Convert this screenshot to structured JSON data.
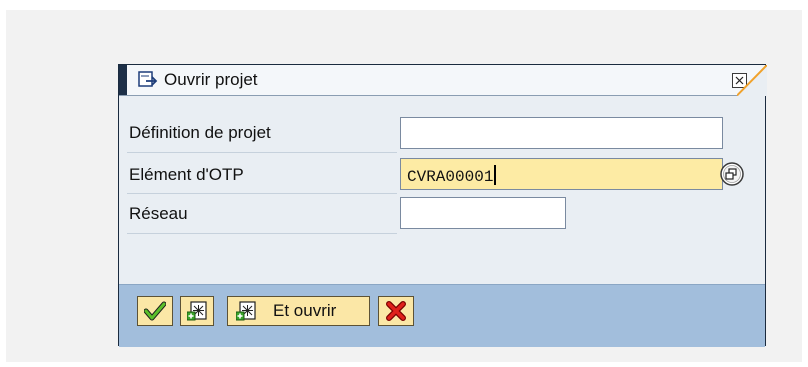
{
  "dialog": {
    "title": "Ouvrir projet",
    "fields": [
      {
        "label": "Définition de projet",
        "value": ""
      },
      {
        "label": "Elément d'OTP",
        "value": "CVRA00001"
      },
      {
        "label": "Réseau",
        "value": ""
      }
    ],
    "buttons": {
      "open_label": "Et ouvrir"
    }
  },
  "colors": {
    "accent": "#f0a22c",
    "active_field": "#fdeba4",
    "footer": "#a2bedc",
    "button_face": "#fbe7a6",
    "title_strip": "#1d2f47"
  }
}
